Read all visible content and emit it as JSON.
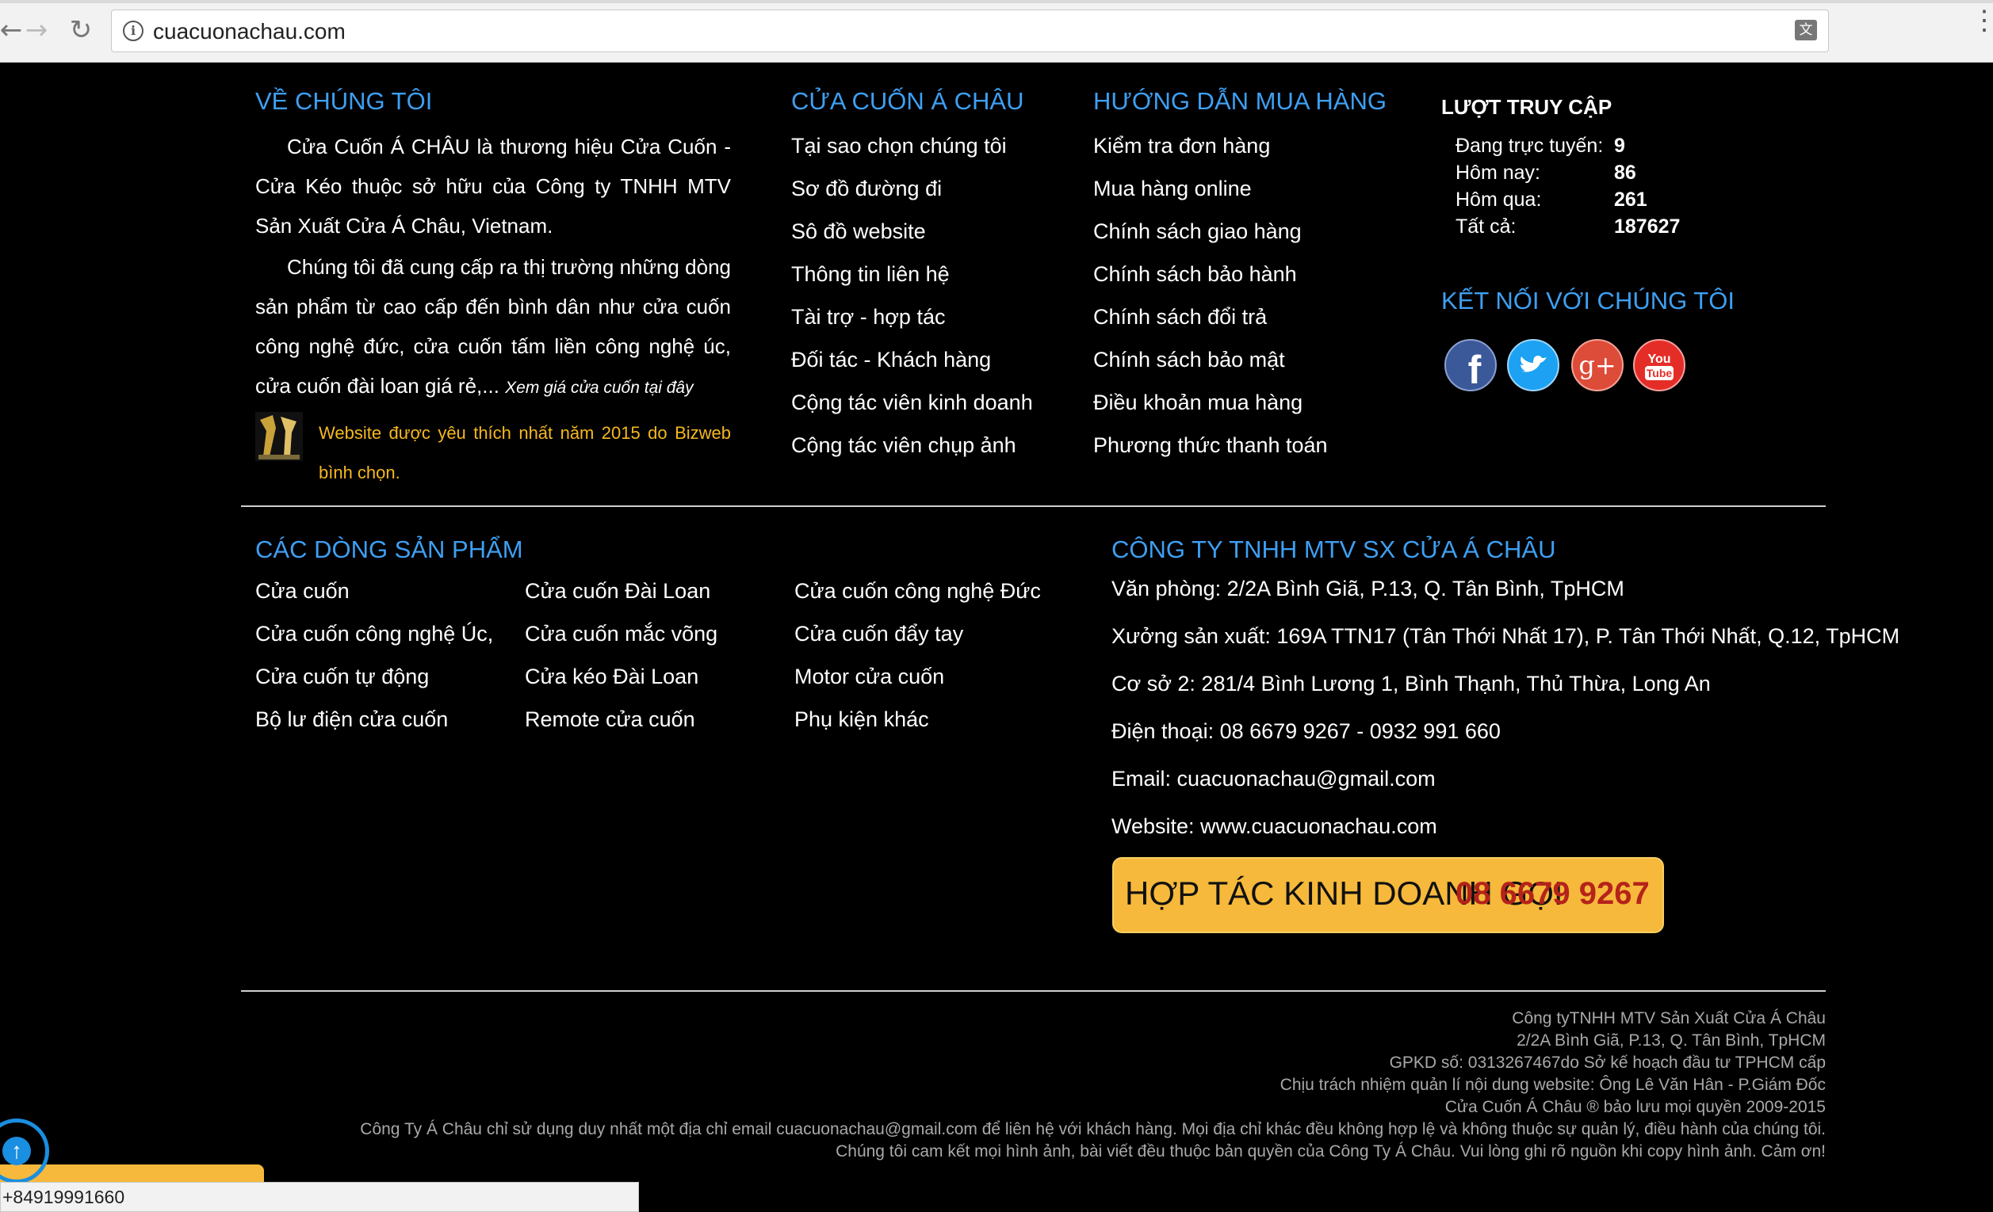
{
  "browser": {
    "url": "cuacuonachau.com",
    "back_glyph": "←",
    "forward_glyph": "→",
    "reload_glyph": "↻",
    "translate_glyph": "文",
    "menu_glyph": "⋮",
    "info_glyph": "i"
  },
  "about": {
    "title": "VỀ CHÚNG TÔI",
    "paragraph1": "Cửa Cuốn Á CHÂU là thương hiệu Cửa Cuốn - Cửa Kéo thuộc sở hữu của Công ty TNHH MTV Sản Xuất Cửa Á Châu, Vietnam.",
    "paragraph2": "Chúng tôi đã cung cấp ra thị trường những dòng sản phẩm từ cao cấp đến bình dân như cửa cuốn công nghệ đức, cửa cuốn tấm liền công nghệ úc, cửa cuốn đài loan giá rẻ,...",
    "price_link": "Xem giá cửa cuốn tại đây",
    "award_text": "Website được yêu thích nhất năm 2015 do Bizweb bình chọn."
  },
  "company_links": {
    "title": "CỬA CUỐN Á CHÂU",
    "items": [
      "Tại sao chọn chúng tôi",
      "Sơ đồ đường đi",
      "Sô đồ website",
      "Thông tin liên hệ",
      "Tài trợ - hợp tác",
      "Đối tác - Khách hàng",
      "Cộng tác viên kinh doanh",
      "Cộng tác viên chụp ảnh"
    ]
  },
  "guide": {
    "title": "HƯỚNG DẪN MUA HÀNG",
    "items": [
      "Kiểm tra đơn hàng",
      "Mua hàng online",
      "Chính sách giao hàng",
      "Chính sách bảo hành",
      "Chính sách đổi trả",
      "Chính sách bảo mật",
      "Điều khoản mua hàng",
      "Phương thức thanh toán"
    ]
  },
  "visits": {
    "title": "LƯỢT TRUY CẬP",
    "rows": [
      {
        "label": "Đang trực tuyến:",
        "value": "9"
      },
      {
        "label": "Hôm nay:",
        "value": "86"
      },
      {
        "label": "Hôm qua:",
        "value": "261"
      },
      {
        "label": "Tất cả:",
        "value": "187627"
      }
    ]
  },
  "connect": {
    "title": "KẾT NỐI VỚI CHÚNG TÔI",
    "facebook_glyph": "f",
    "google_glyph": "g+",
    "youtube_top": "You",
    "youtube_bottom": "Tube"
  },
  "products": {
    "title": "CÁC DÒNG SẢN PHẨM",
    "col1": [
      "Cửa cuốn",
      "Cửa cuốn công nghệ Úc,",
      "Cửa cuốn tự động",
      "Bộ lư điện cửa cuốn"
    ],
    "col2": [
      "Cửa cuốn Đài Loan",
      "Cửa cuốn mắc võng",
      "Cửa kéo Đài Loan",
      "Remote cửa cuốn"
    ],
    "col3": [
      "Cửa cuốn công nghệ Đức",
      "Cửa cuốn đẩy tay",
      "Motor cửa cuốn",
      "Phụ kiện khác"
    ]
  },
  "contact": {
    "title": "CÔNG TY TNHH MTV SX CỬA Á CHÂU",
    "lines": [
      "Văn phòng: 2/2A Bình Giã, P.13, Q. Tân Bình, TpHCM",
      "Xưởng sản xuất: 169A TTN17 (Tân Thới Nhất 17), P. Tân Thới Nhất, Q.12, TpHCM",
      "Cơ sở 2: 281/4 Bình Lương 1, Bình Thạnh, Thủ Thừa, Long An",
      "Điện thoại: 08 6679 9267 - 0932 991 660",
      "Email: cuacuonachau@gmail.com",
      "Website: www.cuacuonachau.com"
    ],
    "cta_text": "HỢP TÁC KINH DOANH GỌI",
    "cta_phone": "08 6679 9267"
  },
  "copyright": {
    "lines": [
      "Công tyTNHH MTV Sản Xuất Cửa Á Châu",
      "2/2A Bình Giã, P.13, Q. Tân Bình, TpHCM",
      "GPKD số: 0313267467do Sở kế hoạch đầu tư TPHCM cấp",
      "Chịu trách nhiệm quản lí nội dung website: Ông Lê Văn Hân - P.Giám Đốc",
      "Cửa Cuốn Á Châu ® bảo lưu mọi quyền 2009-2015",
      "Công Ty Á Châu chỉ sử dụng duy nhất một địa chỉ email cuacuonachau@gmail.com để liên hệ với khách hàng. Mọi địa chỉ khác đều không hợp lệ và không thuộc sự quản lý, điều hành của chúng tôi.",
      "Chúng tôi cam kết mọi hình ảnh, bài viết đều thuộc bản quyền của Công Ty Á Châu. Vui lòng ghi rõ nguồn khi copy hình ảnh. Cảm ơn!"
    ]
  },
  "widgets": {
    "back_to_top_glyph": "↑",
    "status_phone": "+84919991660"
  },
  "colors": {
    "heading_blue": "#3e9ff2",
    "award_gold": "#f6b820",
    "cta_yellow": "#f6b93b",
    "cta_phone_red": "#b5231a",
    "facebook": "#3b5998",
    "twitter": "#1da1f2",
    "google_plus": "#dd4b39",
    "youtube": "#e52d27"
  }
}
